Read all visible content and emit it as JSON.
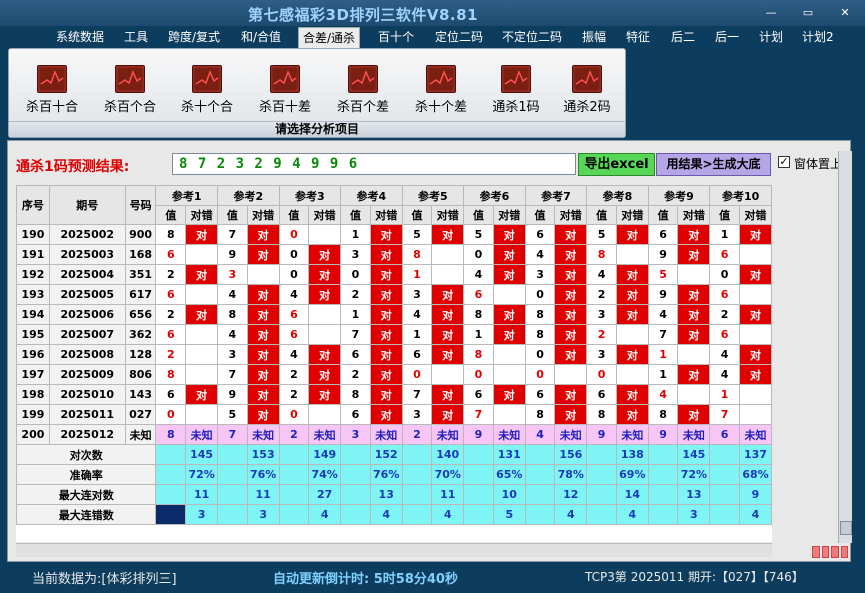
{
  "app": {
    "title": "第七感福彩3D排列三软件V8.81"
  },
  "window_buttons": [
    "—",
    "▭",
    "✕"
  ],
  "menu": [
    "系统数据",
    "工具",
    "跨度/复式",
    "和/合值",
    "合差/通杀",
    "百十个",
    "定位二码",
    "不定位二码",
    "振幅",
    "特征",
    "后二",
    "后一",
    "计划",
    "计划2"
  ],
  "active_menu": "合差/通杀",
  "ribbon": {
    "buttons": [
      "杀百十合",
      "杀百个合",
      "杀十个合",
      "杀百十差",
      "杀百个差",
      "杀十个差",
      "通杀1码",
      "通杀2码"
    ],
    "footer": "请选择分析项目"
  },
  "prediction": {
    "label": "通杀1码预测结果:",
    "value": "8 7 2 3 2 9 4 9 9 6"
  },
  "buttons": {
    "excel": "导出excel",
    "generate": "用结果>生成大底"
  },
  "checkbox": {
    "label": "窗体置上",
    "checked": true,
    "mark": "✓"
  },
  "table": {
    "headers": {
      "seq": "序号",
      "issue": "期号",
      "code": "号码",
      "refs": [
        "参考1",
        "参考2",
        "参考3",
        "参考4",
        "参考5",
        "参考6",
        "参考7",
        "参考8",
        "参考9",
        "参考10"
      ],
      "val": "值",
      "res": "对错"
    },
    "hit_text": "对",
    "rows": [
      {
        "seq": "190",
        "issue": "2025002",
        "code": "900",
        "cells": [
          [
            "8",
            1
          ],
          [
            "7",
            1
          ],
          [
            "0",
            0
          ],
          [
            "1",
            1
          ],
          [
            "5",
            1
          ],
          [
            "5",
            1
          ],
          [
            "6",
            1
          ],
          [
            "5",
            1
          ],
          [
            "6",
            1
          ],
          [
            "1",
            1
          ]
        ]
      },
      {
        "seq": "191",
        "issue": "2025003",
        "code": "168",
        "cells": [
          [
            "6",
            0
          ],
          [
            "9",
            1
          ],
          [
            "0",
            1
          ],
          [
            "3",
            1
          ],
          [
            "8",
            0
          ],
          [
            "0",
            1
          ],
          [
            "4",
            1
          ],
          [
            "8",
            0
          ],
          [
            "9",
            1
          ],
          [
            "6",
            0
          ]
        ]
      },
      {
        "seq": "192",
        "issue": "2025004",
        "code": "351",
        "cells": [
          [
            "2",
            1
          ],
          [
            "3",
            0
          ],
          [
            "0",
            1
          ],
          [
            "0",
            1
          ],
          [
            "1",
            0
          ],
          [
            "4",
            1
          ],
          [
            "3",
            1
          ],
          [
            "4",
            1
          ],
          [
            "5",
            0
          ],
          [
            "0",
            1
          ]
        ]
      },
      {
        "seq": "193",
        "issue": "2025005",
        "code": "617",
        "cells": [
          [
            "6",
            0
          ],
          [
            "4",
            1
          ],
          [
            "4",
            1
          ],
          [
            "2",
            1
          ],
          [
            "3",
            1
          ],
          [
            "6",
            0
          ],
          [
            "0",
            1
          ],
          [
            "2",
            1
          ],
          [
            "9",
            1
          ],
          [
            "6",
            0
          ]
        ]
      },
      {
        "seq": "194",
        "issue": "2025006",
        "code": "656",
        "cells": [
          [
            "2",
            1
          ],
          [
            "8",
            1
          ],
          [
            "6",
            0
          ],
          [
            "1",
            1
          ],
          [
            "4",
            1
          ],
          [
            "8",
            1
          ],
          [
            "8",
            1
          ],
          [
            "3",
            1
          ],
          [
            "4",
            1
          ],
          [
            "2",
            1
          ]
        ]
      },
      {
        "seq": "195",
        "issue": "2025007",
        "code": "362",
        "cells": [
          [
            "6",
            0
          ],
          [
            "4",
            1
          ],
          [
            "6",
            0
          ],
          [
            "7",
            1
          ],
          [
            "1",
            1
          ],
          [
            "1",
            1
          ],
          [
            "8",
            1
          ],
          [
            "2",
            0
          ],
          [
            "7",
            1
          ],
          [
            "6",
            0
          ]
        ]
      },
      {
        "seq": "196",
        "issue": "2025008",
        "code": "128",
        "cells": [
          [
            "2",
            0
          ],
          [
            "3",
            1
          ],
          [
            "4",
            1
          ],
          [
            "6",
            1
          ],
          [
            "6",
            1
          ],
          [
            "8",
            0
          ],
          [
            "0",
            1
          ],
          [
            "3",
            1
          ],
          [
            "1",
            0
          ],
          [
            "4",
            1
          ]
        ]
      },
      {
        "seq": "197",
        "issue": "2025009",
        "code": "806",
        "cells": [
          [
            "8",
            0
          ],
          [
            "7",
            1
          ],
          [
            "2",
            1
          ],
          [
            "2",
            1
          ],
          [
            "0",
            0
          ],
          [
            "0",
            0
          ],
          [
            "0",
            0
          ],
          [
            "0",
            0
          ],
          [
            "1",
            1
          ],
          [
            "4",
            1
          ]
        ]
      },
      {
        "seq": "198",
        "issue": "2025010",
        "code": "143",
        "cells": [
          [
            "6",
            1
          ],
          [
            "9",
            1
          ],
          [
            "2",
            1
          ],
          [
            "8",
            1
          ],
          [
            "7",
            1
          ],
          [
            "6",
            1
          ],
          [
            "6",
            1
          ],
          [
            "6",
            1
          ],
          [
            "4",
            0
          ],
          [
            "1",
            0
          ]
        ]
      },
      {
        "seq": "199",
        "issue": "2025011",
        "code": "027",
        "cells": [
          [
            "0",
            0
          ],
          [
            "5",
            1
          ],
          [
            "0",
            0
          ],
          [
            "6",
            1
          ],
          [
            "3",
            1
          ],
          [
            "7",
            0
          ],
          [
            "8",
            1
          ],
          [
            "8",
            1
          ],
          [
            "8",
            1
          ],
          [
            "7",
            0
          ]
        ]
      }
    ],
    "unknown_row": {
      "seq": "200",
      "issue": "2025012",
      "code": "未知",
      "values": [
        "8",
        "7",
        "2",
        "3",
        "2",
        "9",
        "4",
        "9",
        "9",
        "6"
      ],
      "text": "未知"
    },
    "stats": [
      {
        "label": "对次数",
        "values": [
          "145",
          "153",
          "149",
          "152",
          "140",
          "131",
          "156",
          "138",
          "145",
          "137"
        ]
      },
      {
        "label": "准确率",
        "values": [
          "72%",
          "76%",
          "74%",
          "76%",
          "70%",
          "65%",
          "78%",
          "69%",
          "72%",
          "68%"
        ]
      },
      {
        "label": "最大连对数",
        "values": [
          "11",
          "11",
          "27",
          "13",
          "11",
          "10",
          "12",
          "14",
          "13",
          "9"
        ]
      },
      {
        "label": "最大连错数",
        "values": [
          "3",
          "3",
          "4",
          "4",
          "4",
          "5",
          "4",
          "4",
          "3",
          "4"
        ]
      }
    ]
  },
  "status": {
    "data_source": "当前数据为:[体彩排列三]",
    "countdown": "自动更新倒计时: 5时58分40秒",
    "latest": "TCP3第 2025011 期开:【027】【746】"
  },
  "colors": {
    "hit": "#e00000",
    "stats_bg": "#7ef4f4",
    "unknown_bg": "#f7c6f7",
    "background": "#0d3d5e"
  }
}
